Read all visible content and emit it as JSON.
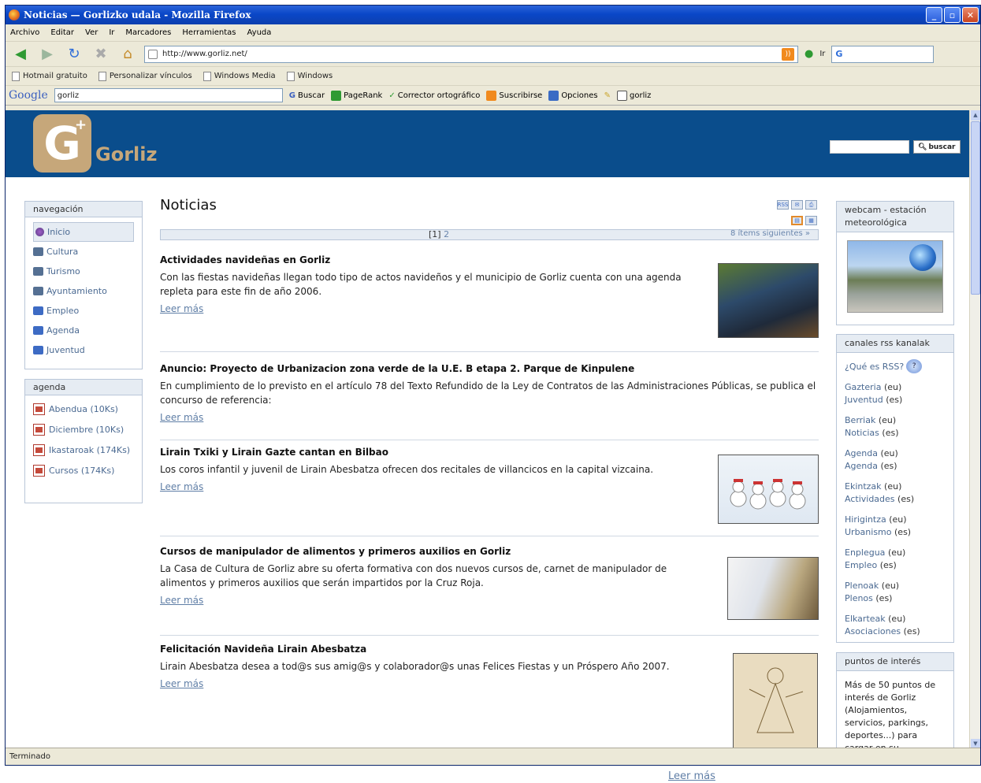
{
  "window": {
    "title": "Noticias — Gorlizko udala - Mozilla Firefox",
    "min": "_",
    "max": "▫",
    "close": "✕"
  },
  "menu": [
    "Archivo",
    "Editar",
    "Ver",
    "Ir",
    "Marcadores",
    "Herramientas",
    "Ayuda"
  ],
  "nav": {
    "url": "http://www.gorliz.net/",
    "go_label": "Ir",
    "search_engine": "G"
  },
  "bookmarks": [
    "Hotmail gratuito",
    "Personalizar vínculos",
    "Windows Media",
    "Windows"
  ],
  "google_toolbar": {
    "logo": "Google",
    "query": "gorliz",
    "buscar": "Buscar",
    "pagerank": "PageRank",
    "corrector": "Corrector ortográfico",
    "suscribirse": "Suscribirse",
    "opciones": "Opciones",
    "term": "gorliz"
  },
  "site": {
    "logo_letter": "G",
    "logo_plus": "+",
    "logo_text": "Gorliz",
    "search_button": "buscar"
  },
  "navegacion": {
    "heading": "navegación",
    "items": [
      "Inicio",
      "Cultura",
      "Turismo",
      "Ayuntamiento",
      "Empleo",
      "Agenda",
      "Juventud"
    ]
  },
  "agenda": {
    "heading": "agenda",
    "items": [
      "Abendua (10Ks)",
      "Diciembre (10Ks)",
      "Ikastaroak (174Ks)",
      "Cursos (174Ks)"
    ]
  },
  "main": {
    "title": "Noticias",
    "pager_current": "[1]",
    "pager_next_page": "2",
    "pager_next": "8 ítems siguientes »",
    "read_more": "Leer más",
    "news": [
      {
        "title": "Actividades navideñas en Gorliz",
        "text": "Con las fiestas navideñas llegan todo tipo de actos navideños y el municipio de Gorliz cuenta con una agenda repleta para este fin de año 2006."
      },
      {
        "title": "Anuncio: Proyecto de Urbanizacion zona verde de la U.E. B etapa 2. Parque de Kinpulene",
        "text": "En cumplimiento de lo previsto en el artículo 78 del Texto Refundido de la Ley de Contratos de las Administraciones Públicas, se publica el concurso de referencia:"
      },
      {
        "title": "Lirain Txiki y Lirain Gazte cantan en Bilbao",
        "text": "Los coros infantil y juvenil de Lirain Abesbatza ofrecen dos recitales de villancicos en la capital vizcaina."
      },
      {
        "title": "Cursos de manipulador de alimentos y primeros auxilios en Gorliz",
        "text": "La Casa de Cultura de Gorliz abre su oferta formativa con dos nuevos cursos de, carnet de manipulador de alimentos y primeros auxilios que serán impartidos por la Cruz Roja."
      },
      {
        "title": "Felicitación Navideña Lirain Abesbatza",
        "text": "Lirain Abesbatza desea a tod@s sus amig@s y colaborador@s unas Felices Fiestas y un Próspero Año 2007."
      }
    ]
  },
  "right": {
    "webcam_heading": "webcam - estación meteorológica",
    "rss_heading": "canales rss kanalak",
    "rss_question": "¿Qué es RSS?",
    "rss_pairs": [
      {
        "eu": "Gazteria",
        "eu_tag": "(eu)",
        "es": "Juventud",
        "es_tag": "(es)"
      },
      {
        "eu": "Berriak",
        "eu_tag": "(eu)",
        "es": "Noticias",
        "es_tag": "(es)"
      },
      {
        "eu": "Agenda",
        "eu_tag": "(eu)",
        "es": "Agenda",
        "es_tag": "(es)"
      },
      {
        "eu": "Ekintzak",
        "eu_tag": "(eu)",
        "es": "Actividades",
        "es_tag": "(es)"
      },
      {
        "eu": "Hirigintza",
        "eu_tag": "(eu)",
        "es": "Urbanismo",
        "es_tag": "(es)"
      },
      {
        "eu": "Enplegua",
        "eu_tag": "(eu)",
        "es": "Empleo",
        "es_tag": "(es)"
      },
      {
        "eu": "Plenoak",
        "eu_tag": "(eu)",
        "es": "Plenos",
        "es_tag": "(es)"
      },
      {
        "eu": "Elkarteak",
        "eu_tag": "(eu)",
        "es": "Asociaciones",
        "es_tag": "(es)"
      }
    ],
    "interest_heading": "puntos de interés",
    "interest_text": "Más de 50 puntos de interés de Gorliz (Alojamientos, servicios, parkings, deportes...) para cargar en su"
  },
  "status": "Terminado",
  "outside_read_more": "Leer más",
  "colors": {
    "header_blue": "#0a4d8c",
    "logo_gold": "#c6a77a",
    "link": "#5f7ea6"
  }
}
